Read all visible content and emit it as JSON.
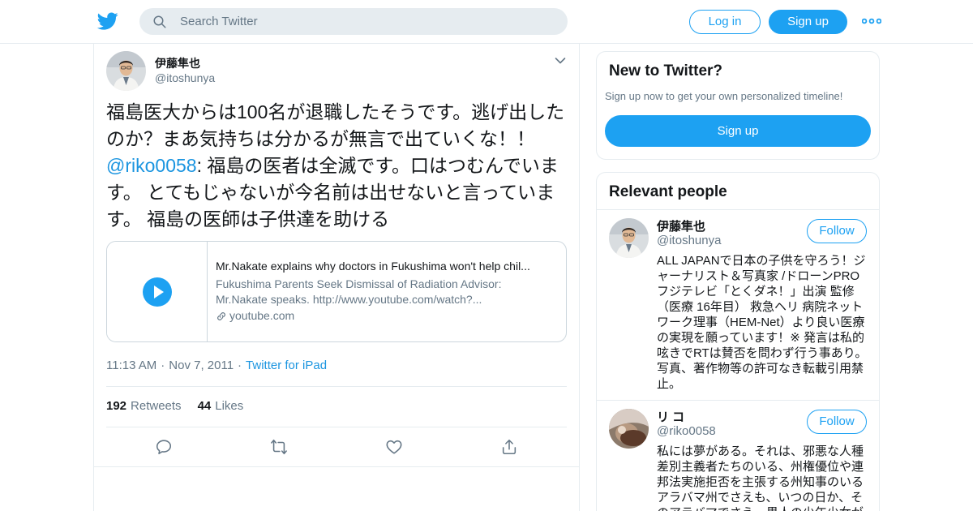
{
  "nav": {
    "search_placeholder": "Search Twitter",
    "login_label": "Log in",
    "signup_label": "Sign up",
    "icons": {
      "logo": "twitter-bird-icon",
      "search": "search-icon",
      "more": "more-dots-icon"
    }
  },
  "tweet": {
    "author_name": "伊藤隼也",
    "author_handle": "@itoshunya",
    "text_part1": "福島医大からは100名が退職したそうです。逃げ出したのか？まあ気持ちは分かるが無言で出ていくな！！",
    "mention": "@riko0058",
    "text_part2": ": 福島の医者は全滅です。口はつむんでいます。 とてもじゃないが今名前は出せないと言っています。 福島の医師は子供達を助ける",
    "card": {
      "title": "Mr.Nakate explains why doctors in Fukushima won't help chil...",
      "description": "Fukushima Parents Seek Dismissal of Radiation Advisor: Mr.Nakate speaks. http://www.youtube.com/watch?...",
      "domain": "youtube.com"
    },
    "time": "11:13 AM",
    "date": "Nov 7, 2011",
    "source": "Twitter for iPad",
    "retweets_count": "192",
    "retweets_label": "Retweets",
    "likes_count": "44",
    "likes_label": "Likes",
    "separator": "·"
  },
  "sidebar": {
    "new_title": "New to Twitter?",
    "new_subtitle": "Sign up now to get your own personalized timeline!",
    "new_signup": "Sign up",
    "people_title": "Relevant people",
    "people": [
      {
        "name": "伊藤隼也",
        "handle": "@itoshunya",
        "follow_label": "Follow",
        "bio": "ALL JAPANで日本の子供を守ろう！ジャーナリスト＆写真家 /ドローンPRO フジテレビ「とくダネ！」出演 監修（医療 16年目） 救急ヘリ 病院ネットワーク理事（HEM-Net）より良い医療の実現を願っています！※ 発言は私的呟きでRTは賛否を問わず行う事あり。写真、著作物等の許可なき転載引用禁止。"
      },
      {
        "name": "リ コ",
        "handle": "@riko0058",
        "follow_label": "Follow",
        "bio": "私には夢がある。それは、邪悪な人種差別主義者たちのいる、州権優位や連邦法実施拒否を主張する州知事のいるアラバマ州でさえも、いつの日か、そのアラバマでさえ、黒人の少年少女が"
      }
    ]
  },
  "colors": {
    "brand": "#1da1f2",
    "link": "#1b95e0",
    "secondary": "#657786",
    "border": "#e6ecf0"
  }
}
